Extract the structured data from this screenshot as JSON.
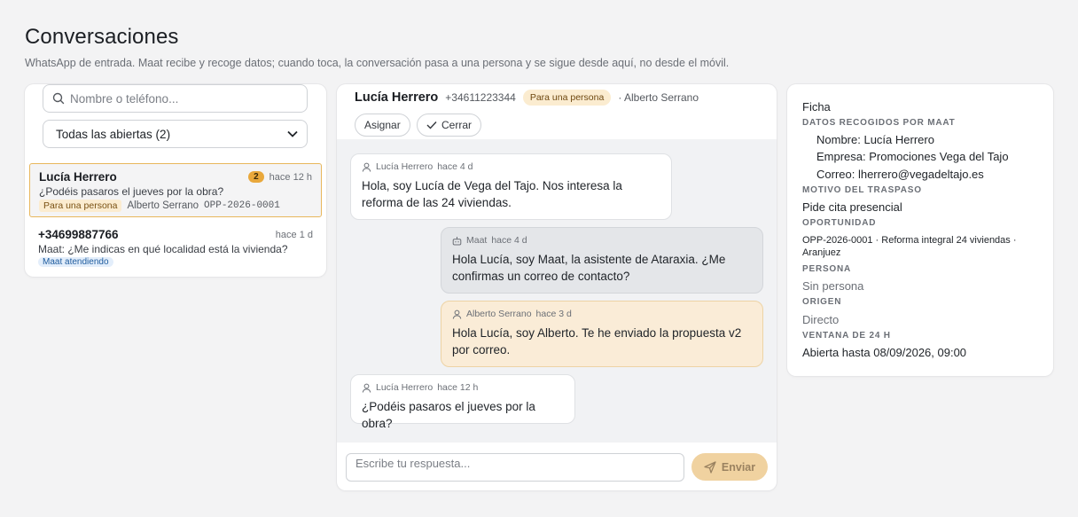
{
  "header": {
    "title": "Conversaciones",
    "subtitle": "WhatsApp de entrada. Maat recibe y recoge datos; cuando toca, la conversación pasa a una persona y se sigue desde aquí, no desde el móvil."
  },
  "sidebar": {
    "search_placeholder": "Nombre o teléfono...",
    "filter_selected": "Todas las abiertas (2)",
    "conversations": [
      {
        "name": "Lucía Herrero",
        "unread": "2",
        "time": "hace 12 h",
        "preview": "¿Podéis pasaros el jueves por la obra?",
        "status": "Para una persona",
        "assignee": "Alberto Serrano",
        "opportunity": "OPP-2026-0001"
      },
      {
        "name": "+34699887766",
        "time": "hace 1 d",
        "preview": "Maat: ¿Me indicas en qué localidad está la vivienda?",
        "status": "Maat atendiendo"
      }
    ]
  },
  "chat": {
    "name": "Lucía Herrero",
    "phone": "+34611223344",
    "status": "Para una persona",
    "assignee": "· Alberto Serrano",
    "assign_label": "Asignar",
    "close_label": "Cerrar",
    "messages": [
      {
        "sender": "Lucía Herrero",
        "time": "hace 4 d",
        "text": "Hola, soy Lucía de Vega del Tajo. Nos interesa la reforma de las 24 viviendas.",
        "kind": "incoming",
        "icon": "user-icon"
      },
      {
        "sender": "Maat",
        "time": "hace 4 d",
        "text": "Hola Lucía, soy Maat, la asistente de Ataraxia. ¿Me confirmas un correo de contacto?",
        "kind": "bot",
        "icon": "bot-icon"
      },
      {
        "sender": "Alberto Serrano",
        "time": "hace 3 d",
        "text": "Hola Lucía, soy Alberto. Te he enviado la propuesta v2 por correo.",
        "kind": "agent",
        "icon": "user-icon"
      },
      {
        "sender": "Lucía Herrero",
        "time": "hace 12 h",
        "text": "¿Podéis pasaros el jueves por la obra?",
        "kind": "incoming",
        "icon": "user-icon"
      }
    ],
    "composer_placeholder": "Escribe tu respuesta...",
    "send_label": "Enviar"
  },
  "ficha": {
    "title": "Ficha",
    "datos_label": "Datos recogidos por Maat",
    "nombre": "Nombre: Lucía Herrero",
    "empresa": "Empresa: Promociones Vega del Tajo",
    "correo": "Correo: lherrero@vegadeltajo.es",
    "motivo_label": "Motivo del traspaso",
    "motivo": "Pide cita presencial",
    "oportunidad_label": "Oportunidad",
    "oportunidad": "OPP-2026-0001 · Reforma integral 24 viviendas · Aranjuez",
    "persona_label": "Persona",
    "persona": "Sin persona",
    "origen_label": "Origen",
    "origen": "Directo",
    "ventana_label": "Ventana de 24 h",
    "ventana": "Abierta hasta 08/09/2026, 09:00"
  },
  "colors": {
    "accent": "#e9a83b",
    "handoff_bg": "#fbecd0",
    "bot_tag_bg": "#e3eefb",
    "agent_bubble": "#faecd7",
    "bot_bubble": "#e4e6e9"
  }
}
